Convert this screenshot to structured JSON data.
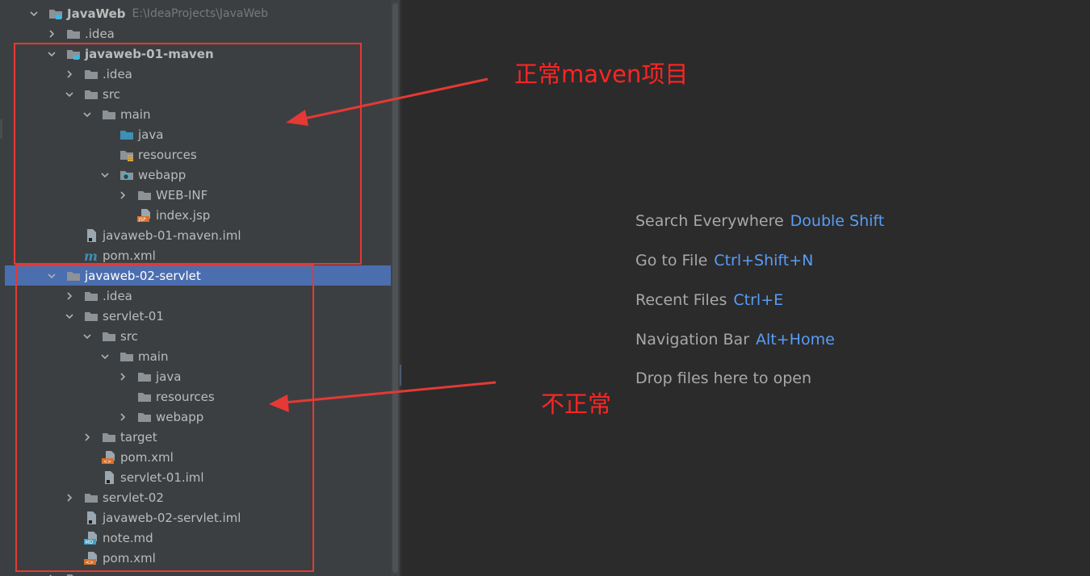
{
  "project_tree": {
    "root": {
      "name": "JavaWeb",
      "path": "E:\\IdeaProjects\\JavaWeb"
    },
    "rows": [
      {
        "label": "JavaWeb",
        "depth": 0,
        "chevron": "down",
        "icon": "module-folder-icon",
        "bold": true,
        "path": "E:\\IdeaProjects\\JavaWeb"
      },
      {
        "label": ".idea",
        "depth": 1,
        "chevron": "right",
        "icon": "folder-icon"
      },
      {
        "label": "javaweb-01-maven",
        "depth": 1,
        "chevron": "down",
        "icon": "module-folder-icon",
        "bold": true
      },
      {
        "label": ".idea",
        "depth": 2,
        "chevron": "right",
        "icon": "folder-icon"
      },
      {
        "label": "src",
        "depth": 2,
        "chevron": "down",
        "icon": "folder-icon"
      },
      {
        "label": "main",
        "depth": 3,
        "chevron": "down",
        "icon": "folder-icon"
      },
      {
        "label": "java",
        "depth": 4,
        "chevron": "none",
        "icon": "source-folder-icon"
      },
      {
        "label": "resources",
        "depth": 4,
        "chevron": "none",
        "icon": "resources-folder-icon"
      },
      {
        "label": "webapp",
        "depth": 4,
        "chevron": "down",
        "icon": "web-folder-icon"
      },
      {
        "label": "WEB-INF",
        "depth": 5,
        "chevron": "right",
        "icon": "folder-icon"
      },
      {
        "label": "index.jsp",
        "depth": 5,
        "chevron": "none",
        "icon": "jsp-file-icon"
      },
      {
        "label": "javaweb-01-maven.iml",
        "depth": 2,
        "chevron": "none",
        "icon": "iml-file-icon"
      },
      {
        "label": "pom.xml",
        "depth": 2,
        "chevron": "none",
        "icon": "maven-pom-icon"
      },
      {
        "label": "javaweb-02-servlet",
        "depth": 1,
        "chevron": "down",
        "icon": "folder-icon",
        "selected": true
      },
      {
        "label": ".idea",
        "depth": 2,
        "chevron": "right",
        "icon": "folder-icon"
      },
      {
        "label": "servlet-01",
        "depth": 2,
        "chevron": "down",
        "icon": "folder-icon"
      },
      {
        "label": "src",
        "depth": 3,
        "chevron": "down",
        "icon": "folder-icon"
      },
      {
        "label": "main",
        "depth": 4,
        "chevron": "down",
        "icon": "folder-icon"
      },
      {
        "label": "java",
        "depth": 5,
        "chevron": "right",
        "icon": "folder-icon"
      },
      {
        "label": "resources",
        "depth": 5,
        "chevron": "none",
        "icon": "folder-icon"
      },
      {
        "label": "webapp",
        "depth": 5,
        "chevron": "right",
        "icon": "folder-icon"
      },
      {
        "label": "target",
        "depth": 3,
        "chevron": "right",
        "icon": "folder-icon"
      },
      {
        "label": "pom.xml",
        "depth": 3,
        "chevron": "none",
        "icon": "xml-file-icon"
      },
      {
        "label": "servlet-01.iml",
        "depth": 3,
        "chevron": "none",
        "icon": "iml-file-icon"
      },
      {
        "label": "servlet-02",
        "depth": 2,
        "chevron": "right",
        "icon": "folder-icon"
      },
      {
        "label": "javaweb-02-servlet.iml",
        "depth": 2,
        "chevron": "none",
        "icon": "iml-file-icon"
      },
      {
        "label": "note.md",
        "depth": 2,
        "chevron": "none",
        "icon": "markdown-file-icon"
      },
      {
        "label": "pom.xml",
        "depth": 2,
        "chevron": "none",
        "icon": "xml-file-icon"
      },
      {
        "label": "",
        "depth": 1,
        "chevron": "right",
        "icon": "folder-icon"
      }
    ]
  },
  "editor_placeholder": {
    "hints": [
      {
        "text": "Search Everywhere",
        "key": "Double Shift"
      },
      {
        "text": "Go to File",
        "key": "Ctrl+Shift+N"
      },
      {
        "text": "Recent Files",
        "key": "Ctrl+E"
      },
      {
        "text": "Navigation Bar",
        "key": "Alt+Home"
      },
      {
        "text": "Drop files here to open",
        "key": ""
      }
    ]
  },
  "annotations": {
    "normal_label": "正常maven项目",
    "abnormal_label": "不正常",
    "color": "#ff2424"
  },
  "colors": {
    "panel_bg": "#3c3f41",
    "editor_bg": "#2b2b2b",
    "selection": "#4b6eaf",
    "shortcut": "#589df6",
    "folder": "#8d9296",
    "source_folder": "#3d8fb6"
  }
}
